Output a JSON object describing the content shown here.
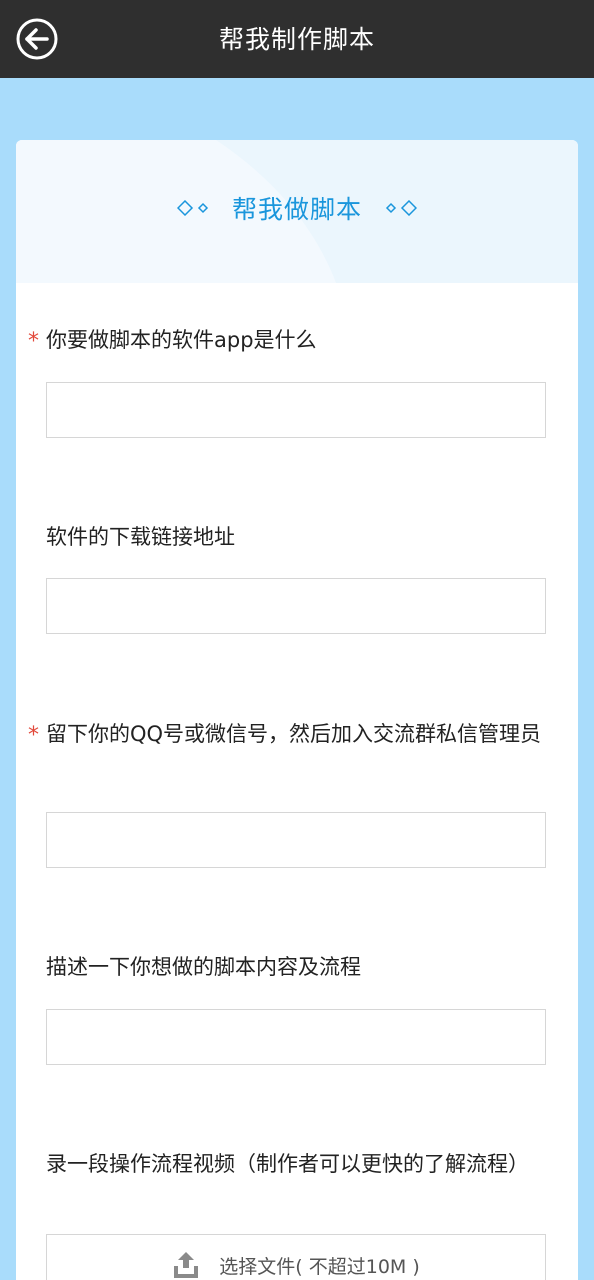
{
  "app_bar": {
    "title": "帮我制作脚本",
    "back_icon": "back-arrow-icon"
  },
  "form_header": {
    "title": "帮我做脚本",
    "left_deco": "diamond-decoration-icon",
    "right_deco": "diamond-decoration-icon",
    "accent_color": "#1a96dc",
    "header_bg": "#ebf6fd"
  },
  "form": {
    "fields": [
      {
        "label": "你要做脚本的软件app是什么",
        "required": true,
        "required_mark": "*",
        "value": "",
        "placeholder": ""
      },
      {
        "label": "软件的下载链接地址",
        "required": false,
        "value": "",
        "placeholder": ""
      },
      {
        "label": "留下你的QQ号或微信号，然后加入交流群私信管理员",
        "required": true,
        "required_mark": "*",
        "value": "",
        "placeholder": ""
      },
      {
        "label": "描述一下你想做的脚本内容及流程",
        "required": false,
        "value": "",
        "placeholder": ""
      },
      {
        "label": "录一段操作流程视频（制作者可以更快的了解流程）",
        "required": false
      }
    ],
    "upload": {
      "label": "选择文件( 不超过10M )",
      "icon": "upload-icon"
    }
  },
  "colors": {
    "page_bg": "#a9dcfb",
    "topbar_bg": "#2f2f2f",
    "required_color": "#e2493b"
  }
}
